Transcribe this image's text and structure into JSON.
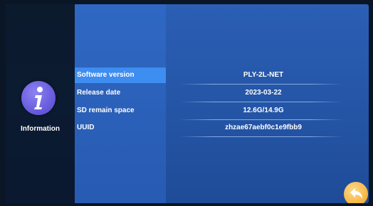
{
  "sidebar": {
    "info_item": {
      "label": "Information",
      "icon": "info-icon",
      "icon_color": "#6c5fe0"
    }
  },
  "info_rows": [
    {
      "label": "Software version",
      "value": "PLY-2L-NET",
      "selected": true
    },
    {
      "label": "Release date",
      "value": "2023-03-22",
      "selected": false
    },
    {
      "label": "SD remain space",
      "value": "12.6G/14.9G",
      "selected": false
    },
    {
      "label": "UUID",
      "value": "zhzae67aebf0c1e9fbb9",
      "selected": false
    }
  ],
  "back_button": {
    "icon": "back-arrow-icon",
    "color": "#f6b94a"
  },
  "colors": {
    "selected_row": "#3e8df0",
    "panel_blue": "#2556a8",
    "sidebar_dark": "#0b1b31"
  }
}
